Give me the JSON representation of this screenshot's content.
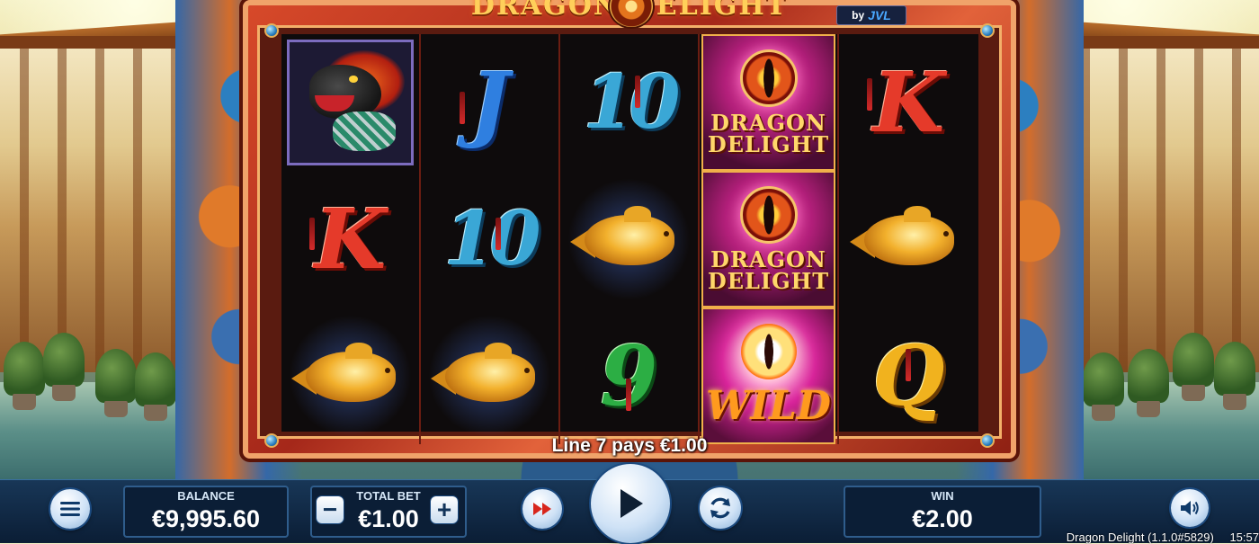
{
  "game": {
    "logo_text": "DRAGON DELIGHT",
    "provider_by": "by",
    "provider_name": "JVL"
  },
  "reels": [
    [
      "dragon",
      "K",
      "golden-fish"
    ],
    [
      "J",
      "10",
      "golden-fish"
    ],
    [
      "10",
      "golden-fish",
      "9"
    ],
    [
      "dragon-delight-scatter",
      "dragon-delight-scatter",
      "wild"
    ],
    [
      "K",
      "golden-fish",
      "Q"
    ]
  ],
  "symbols": {
    "scatter_line1": "DRAGON",
    "scatter_line2": "DELIGHT",
    "wild_text": "WILD"
  },
  "win_message": "Line 7 pays €1.00",
  "controls": {
    "balance_label": "BALANCE",
    "balance_value": "€9,995.60",
    "total_bet_label": "TOTAL BET",
    "total_bet_value": "€1.00",
    "bet_decrease": "−",
    "bet_increase": "+",
    "win_label": "WIN",
    "win_value": "€2.00"
  },
  "icons": {
    "menu": "hamburger-icon",
    "turbo": "fast-forward-icon",
    "spin": "play-icon",
    "autoplay": "refresh-icon",
    "sound": "speaker-icon"
  },
  "footer": {
    "game_version": "Dragon Delight (1.1.0#5829)",
    "clock": "15:57"
  }
}
